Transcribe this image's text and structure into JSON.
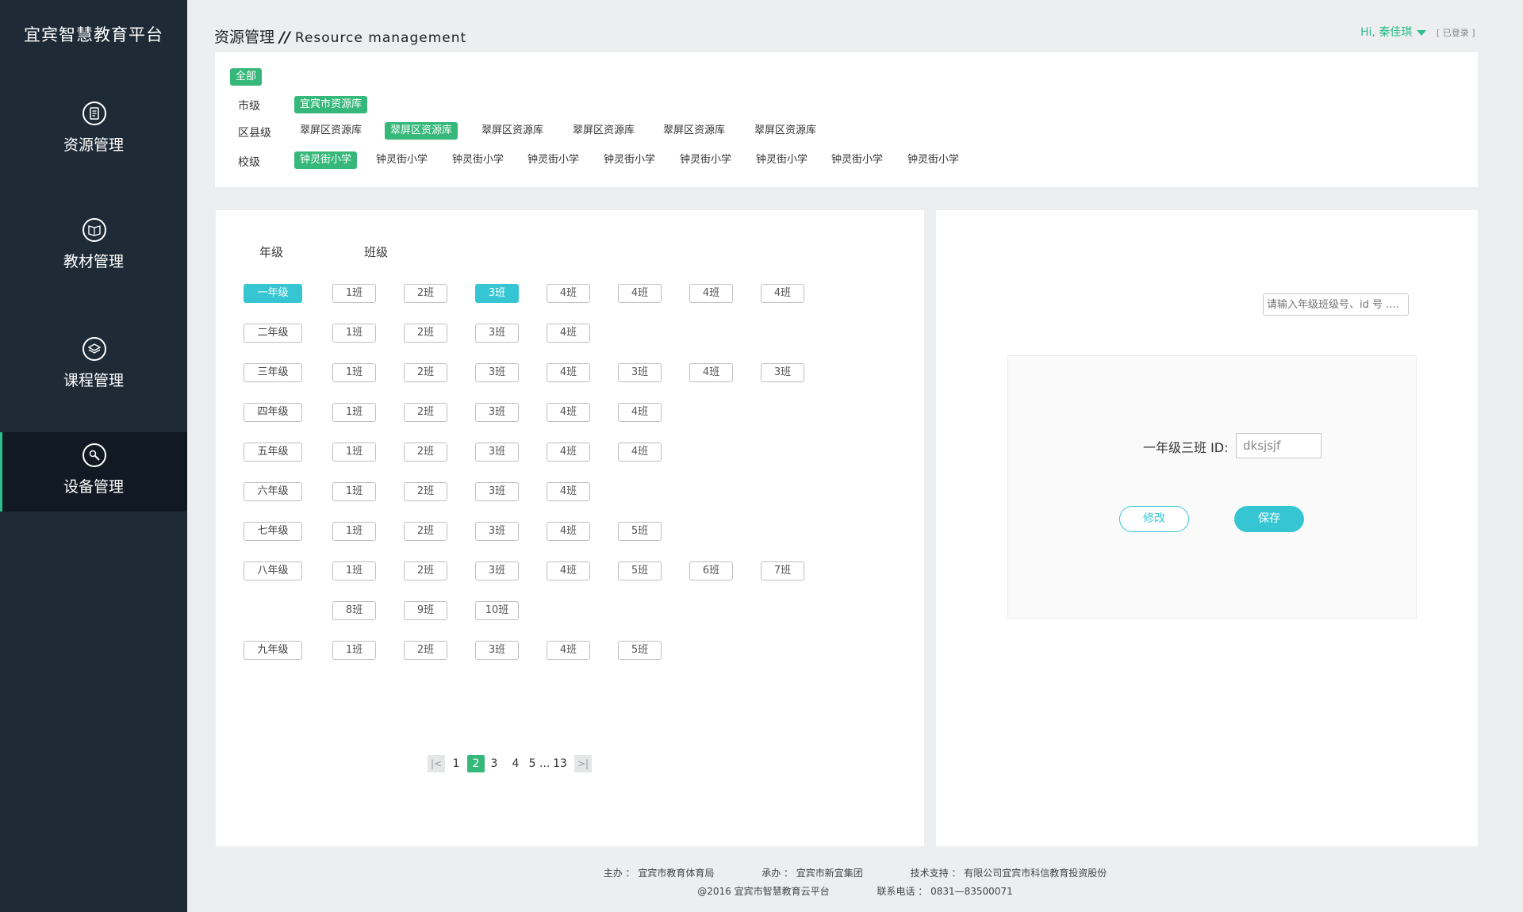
{
  "app": {
    "logo": "宜宾智慧教育平台"
  },
  "sidebar": {
    "items": [
      {
        "label": "资源管理",
        "icon": "document-icon"
      },
      {
        "label": "教材管理",
        "icon": "book-icon"
      },
      {
        "label": "课程管理",
        "icon": "layers-icon"
      },
      {
        "label": "设备管理",
        "icon": "wrench-icon"
      }
    ],
    "active_index": 3
  },
  "header": {
    "title_cn": "资源管理",
    "separator": "//",
    "title_en": "Resource management",
    "user": "Hi, 秦佳琪",
    "status": "[ 已登录 ]"
  },
  "filter": {
    "all_label": "全部",
    "city": {
      "label": "市级",
      "items": [
        "宜宾市资源库"
      ],
      "selected": 0
    },
    "district": {
      "label": "区县级",
      "items": [
        "翠屏区资源库",
        "翠屏区资源库",
        "翠屏区资源库",
        "翠屏区资源库",
        "翠屏区资源库",
        "翠屏区资源库"
      ],
      "selected": 1
    },
    "school": {
      "label": "校级",
      "items": [
        "钟灵街小学",
        "钟灵街小学",
        "钟灵街小学",
        "钟灵街小学",
        "钟灵街小学",
        "钟灵街小学",
        "钟灵街小学",
        "钟灵街小学",
        "钟灵街小学"
      ],
      "selected": 0
    }
  },
  "grid": {
    "grade_header": "年级",
    "class_header": "班级",
    "grades": [
      {
        "label": "一年级",
        "selected": true,
        "classes": [
          "1班",
          "2班",
          "3班",
          "4班",
          "4班",
          "4班",
          "4班"
        ],
        "selected_class": 2
      },
      {
        "label": "二年级",
        "classes": [
          "1班",
          "2班",
          "3班",
          "4班"
        ]
      },
      {
        "label": "三年级",
        "classes": [
          "1班",
          "2班",
          "3班",
          "4班",
          "3班",
          "4班",
          "3班"
        ]
      },
      {
        "label": "四年级",
        "classes": [
          "1班",
          "2班",
          "3班",
          "4班",
          "4班"
        ]
      },
      {
        "label": "五年级",
        "classes": [
          "1班",
          "2班",
          "3班",
          "4班",
          "4班"
        ]
      },
      {
        "label": "六年级",
        "classes": [
          "1班",
          "2班",
          "3班",
          "4班"
        ]
      },
      {
        "label": "七年级",
        "classes": [
          "1班",
          "2班",
          "3班",
          "4班",
          "5班"
        ]
      },
      {
        "label": "八年级",
        "classes": [
          "1班",
          "2班",
          "3班",
          "4班",
          "5班",
          "6班",
          "7班"
        ]
      },
      {
        "label": "",
        "classes": [
          "8班",
          "9班",
          "10班"
        ]
      },
      {
        "label": "九年级",
        "classes": [
          "1班",
          "2班",
          "3班",
          "4班",
          "5班"
        ]
      }
    ]
  },
  "pagination": {
    "first_icon": "first-page-icon",
    "last_icon": "last-page-icon",
    "pages": [
      "1",
      "2",
      "3",
      "4",
      "5 ...",
      "13"
    ],
    "current": "2"
  },
  "detail": {
    "search_placeholder": "请输入年级班级号、id 号 ....",
    "id_label": "一年级三班 ID:",
    "id_value": "dksjsjf",
    "edit_label": "修改",
    "save_label": "保存"
  },
  "footer": {
    "line1": [
      "主办 ： 宜宾市教育体育局",
      "承办 ： 宜宾市新宜集团",
      "技术支持 ： 有限公司宜宾市科信教育投资股份"
    ],
    "line2": [
      "@2016   宜宾市智慧教育云平台",
      "联系电话 ： 0831—83500071"
    ]
  },
  "colors": {
    "sidebar": "#1e2a36",
    "green": "#35b879",
    "cyan": "#36c6d3"
  }
}
